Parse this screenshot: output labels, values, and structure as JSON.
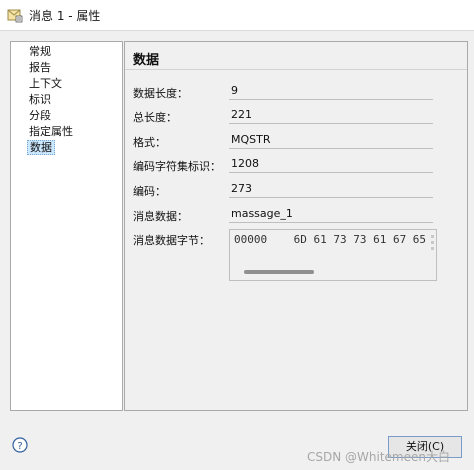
{
  "window": {
    "title": "消息 1 - 属性"
  },
  "nav": {
    "items": [
      {
        "label": "常规"
      },
      {
        "label": "报告"
      },
      {
        "label": "上下文"
      },
      {
        "label": "标识"
      },
      {
        "label": "分段"
      },
      {
        "label": "指定属性"
      },
      {
        "label": "数据"
      }
    ],
    "selected": "数据"
  },
  "panel": {
    "title": "数据",
    "fields": [
      {
        "label": "数据长度：",
        "value": "9"
      },
      {
        "label": "总长度：",
        "value": "221"
      },
      {
        "label": "格式：",
        "value": "MQSTR"
      },
      {
        "label": "编码字符集标识：",
        "value": "1208"
      },
      {
        "label": "编码：",
        "value": "273"
      },
      {
        "label": "消息数据：",
        "value": "massage_1"
      }
    ],
    "bytes": {
      "label": "消息数据字节：",
      "text": "00000    6D 61 73 73 61 67 65"
    }
  },
  "footer": {
    "close_label": "关闭(C)",
    "help_icon": "help-icon"
  },
  "watermark": "CSDN @Whitemeen大白",
  "colors": {
    "selection": "#cce8ff",
    "button_border": "#7a9cc8"
  }
}
